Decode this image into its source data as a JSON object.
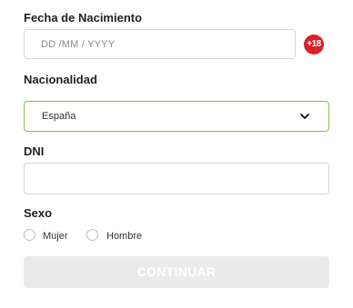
{
  "birthdate": {
    "label": "Fecha de Nacimiento",
    "placeholder": "DD /MM / YYYY",
    "value": "",
    "age_badge": "+18"
  },
  "nationality": {
    "label": "Nacionalidad",
    "selected": "España"
  },
  "dni": {
    "label": "DNI",
    "value": ""
  },
  "sex": {
    "label": "Sexo",
    "options": [
      {
        "label": "Mujer",
        "selected": false
      },
      {
        "label": "Hombre",
        "selected": false
      }
    ]
  },
  "submit": {
    "label": "CONTINUAR",
    "enabled": false
  },
  "colors": {
    "accent_green": "#7cc34a",
    "badge_red": "#d9202b",
    "button_disabled_bg": "#ebebeb"
  },
  "icons": {
    "select_toggle": "chevron-down-icon",
    "age_restriction": "plus-18-badge-icon"
  }
}
